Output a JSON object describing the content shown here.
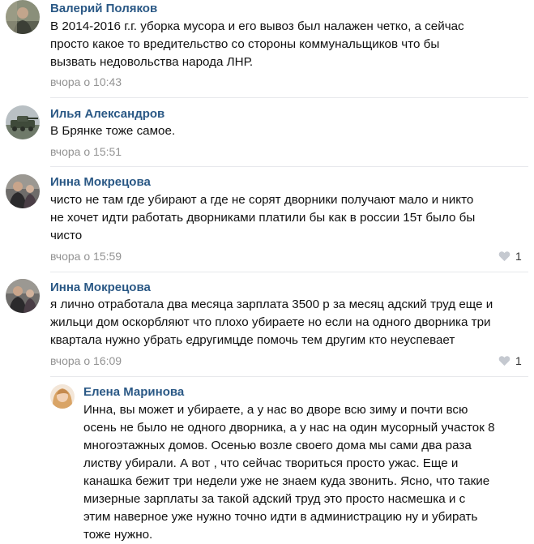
{
  "comments": [
    {
      "author": "Валерий Поляков",
      "lines": [
        "В 2014-2016 г.г. уборка мусора и его вывоз был налажен четко, а сейчас",
        "просто какое то вредительство со стороны коммунальщиков что бы",
        "вызвать недовольства народа ЛНР."
      ],
      "date": "вчора о 10:43"
    },
    {
      "author": "Илья Александров",
      "lines": [
        "В Брянке тоже самое."
      ],
      "date": "вчора о 15:51"
    },
    {
      "author": "Инна Мокрецова",
      "lines": [
        "чисто не там где убирают а где не сорят дворники получают мало и никто",
        "не хочет идти работать дворниками платили бы как в россии 15т было бы",
        "чисто"
      ],
      "date": "вчора о 15:59",
      "likes": "1"
    },
    {
      "author": "Инна Мокрецова",
      "lines": [
        "я лично отработала два месяца зарплата 3500 р за месяц адский труд еще и",
        "жильци дом оскорбляют что плохо убираете но если на одного дворника три",
        "квартала нужно убрать едругимцде помочь тем другим кто неуспевает"
      ],
      "date": "вчора о 16:09",
      "likes": "1"
    },
    {
      "author": "Елена Маринова",
      "lines": [
        "Инна, вы может и убираете, а у нас во дворе всю зиму и почти всю",
        "осень не было не одного дворника, а у нас на один мусорный участок 8",
        "многоэтажных домов. Осенью возле своего дома мы сами два раза",
        "листву убирали. А вот , что сейчас твориться просто ужас. Еще и",
        "канашка бежит три недели уже не знаем куда звонить. Ясно, что такие",
        "мизерные зарплаты за такой адский труд это просто насмешка и с",
        "этим наверное уже нужно точно идти в администрацию ну и убирать",
        "тоже нужно."
      ]
    }
  ],
  "colors": {
    "author": "#2a5885",
    "date": "#939393",
    "heart": "#c5c9d0",
    "separator": "#e7e8ec"
  }
}
